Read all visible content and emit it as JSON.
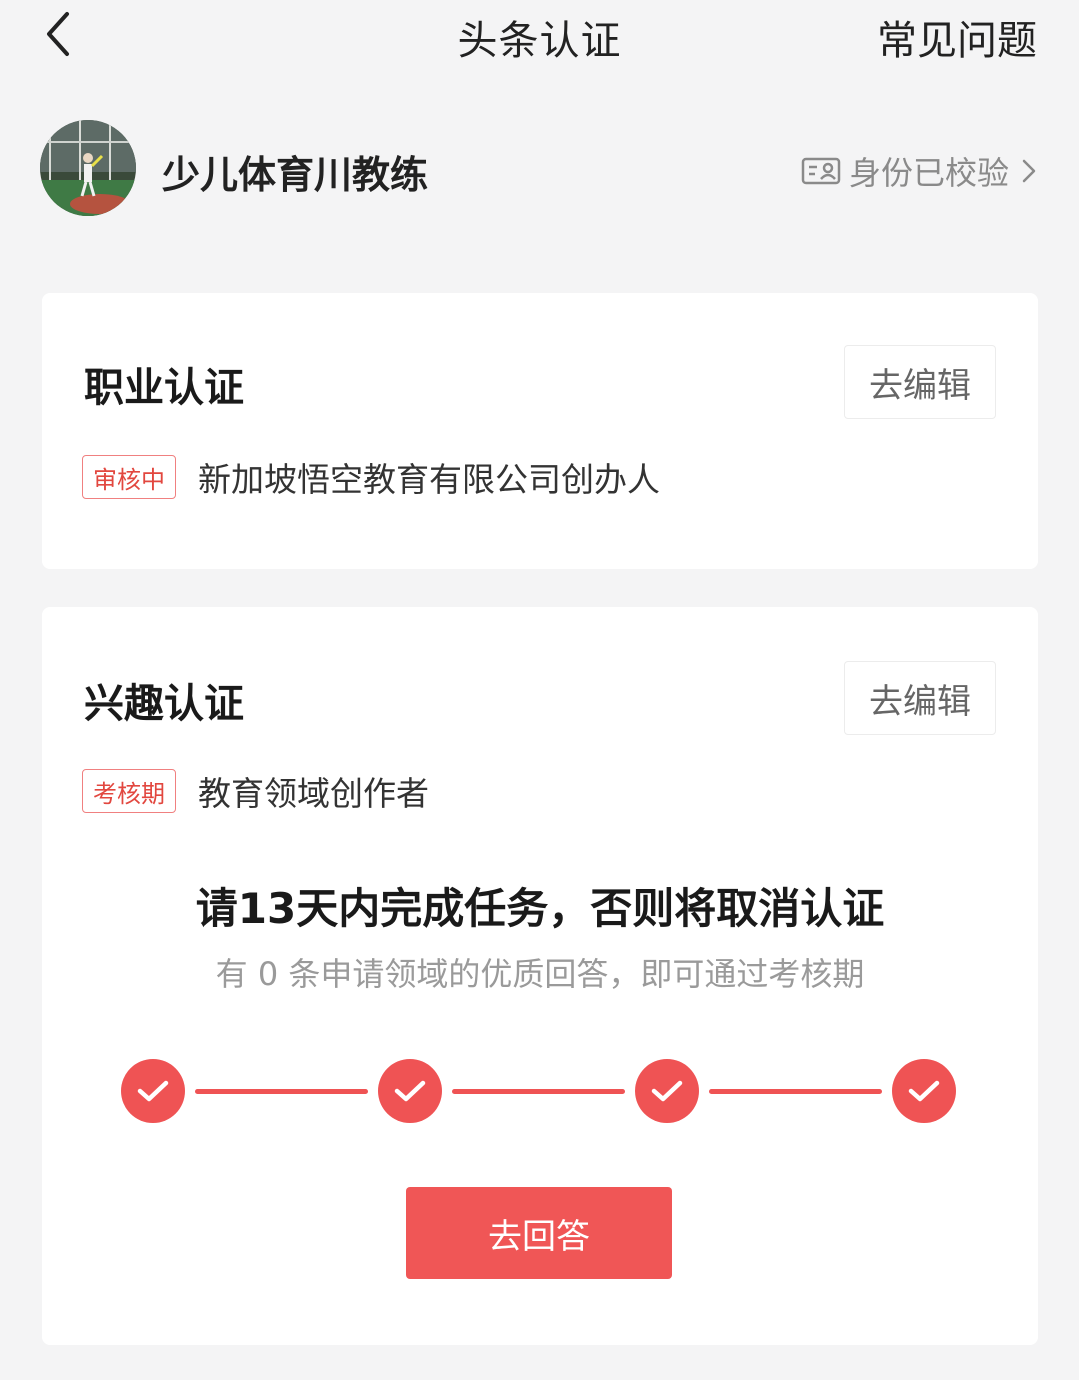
{
  "header": {
    "title": "头条认证",
    "faq_label": "常见问题"
  },
  "profile": {
    "username": "少儿体育川教练",
    "verified_label": "身份已校验"
  },
  "professional": {
    "title": "职业认证",
    "edit_label": "去编辑",
    "status_tag": "审核中",
    "description": "新加坡悟空教育有限公司创办人"
  },
  "interest": {
    "title": "兴趣认证",
    "edit_label": "去编辑",
    "status_tag": "考核期",
    "description": "教育领域创作者",
    "task_title": "请13天内完成任务，否则将取消认证",
    "task_desc": "有 0 条申请领域的优质回答，即可通过考核期",
    "steps_completed": 4,
    "steps_total": 4,
    "answer_button_label": "去回答"
  },
  "colors": {
    "accent": "#ef5354",
    "tag_text": "#e2473f",
    "background": "#f4f4f5"
  },
  "icons": {
    "back": "chevron-left-icon",
    "id_card": "id-card-icon",
    "chevron": "chevron-right-icon",
    "check": "check-icon"
  }
}
